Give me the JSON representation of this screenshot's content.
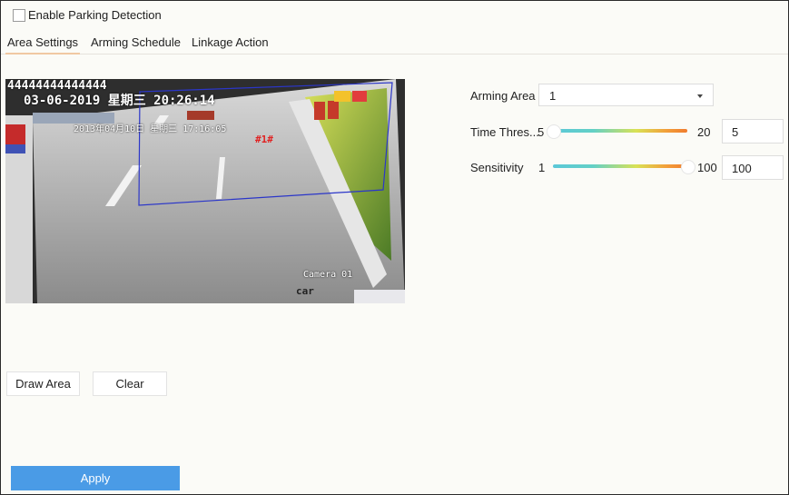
{
  "enable_parking_detection": {
    "label": "Enable Parking Detection",
    "checked": false
  },
  "tabs": [
    {
      "label": "Area Settings",
      "active": true
    },
    {
      "label": "Arming Schedule",
      "active": false
    },
    {
      "label": "Linkage Action",
      "active": false
    }
  ],
  "video": {
    "osd_top": "44444444444444",
    "osd_datetime": "03-06-2019 星期三 20:26:14",
    "inner_datetime": "2013年04月10日 星期三 17:16:05",
    "zone_tag": "#1#",
    "camera_label": "Camera 01",
    "road_text": "car"
  },
  "settings": {
    "arming_area": {
      "label": "Arming Area",
      "value": "1"
    },
    "time_threshold": {
      "label": "Time Thres...",
      "min": "5",
      "max": "20",
      "value": "5",
      "level": 0.0
    },
    "sensitivity": {
      "label": "Sensitivity",
      "min": "1",
      "max": "100",
      "value": "100",
      "level": 1.0
    }
  },
  "buttons": {
    "draw_area": "Draw Area",
    "clear": "Clear",
    "apply": "Apply"
  },
  "colors": {
    "apply_bg": "#4a9be6",
    "region_outline": "#2b36c9",
    "tab_underline": "#f0c8a3"
  }
}
